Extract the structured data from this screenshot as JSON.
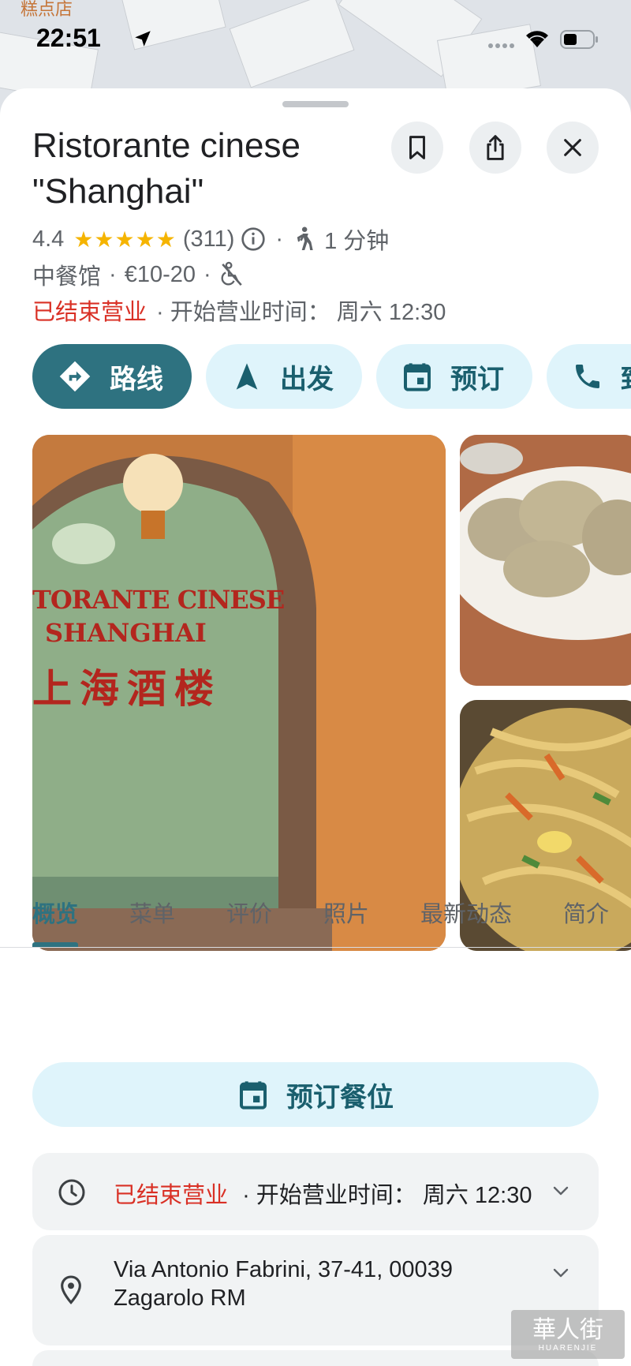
{
  "map": {
    "label": "糕点店"
  },
  "status_bar": {
    "time": "22:51"
  },
  "place": {
    "name": "Ristorante cinese \"Shanghai\"",
    "rating": "4.4",
    "stars": "★★★★★",
    "review_count": "(311)",
    "walk_time": "1 分钟",
    "category": "中餐馆",
    "price": "€10-20",
    "status_closed": "已结束营业",
    "opens": "· 开始营业时间： 周六 12:30",
    "icons": [
      "bookmark-icon",
      "share-icon",
      "close-icon",
      "info-icon",
      "walk-icon",
      "no-wheelchair-icon"
    ]
  },
  "actions": [
    {
      "label": "路线",
      "icon": "directions-icon"
    },
    {
      "label": "出发",
      "icon": "navigation-icon"
    },
    {
      "label": "预订",
      "icon": "calendar-icon"
    },
    {
      "label": "致电",
      "icon": "phone-icon"
    }
  ],
  "photos": {
    "sign_line1": "TORANTE CINESE",
    "sign_line2": "SHANGHAI",
    "sign_line3": "上海酒楼"
  },
  "tabs": [
    "概览",
    "菜单",
    "评价",
    "照片",
    "最新动态",
    "简介"
  ],
  "reserve": {
    "label": "预订餐位"
  },
  "hours": {
    "closed": "已结束营业",
    "opens": "· 开始营业时间： 周六 12:30"
  },
  "address": {
    "line1": "Via Antonio Fabrini, 37-41, 00039",
    "line2": "Zagarolo RM"
  },
  "watermark": {
    "cn": "華人街",
    "en": "HUARENJIE"
  },
  "colors": {
    "accent": "#2e7280",
    "pill_bg": "#dff4fb",
    "closed": "#d93025",
    "star": "#f5b400"
  }
}
